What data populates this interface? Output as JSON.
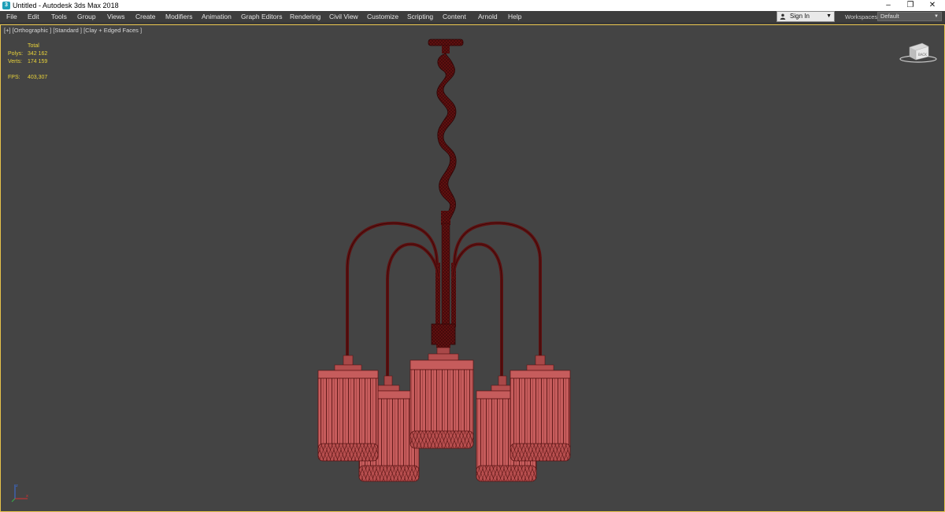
{
  "window": {
    "title": "Untitled - Autodesk 3ds Max 2018",
    "app_icon_glyph": "3",
    "controls": [
      "minimize-icon",
      "restore-icon",
      "close-icon"
    ]
  },
  "menu": [
    "File",
    "Edit",
    "Tools",
    "Group",
    "Views",
    "Create",
    "Modifiers",
    "Animation",
    "Graph Editors",
    "Rendering",
    "Civil View",
    "Customize",
    "Scripting",
    "Content",
    "Arnold",
    "Help"
  ],
  "account": {
    "sign_in_label": "Sign In"
  },
  "workspaces": {
    "label": "Workspaces:",
    "selected": "Default"
  },
  "viewport": {
    "label": "[+] [Orthographic ] [Standard ] [Clay + Edged Faces ]",
    "stats": {
      "header": "Total",
      "polys_label": "Polys:",
      "polys_value": "342 162",
      "verts_label": "Verts:",
      "verts_value": "174 159",
      "fps_label": "FPS:",
      "fps_value": "403,307"
    }
  },
  "colors": {
    "viewport_bg": "#444444",
    "model_fill": "#c65c5c",
    "model_wire": "#5a1414",
    "stats_text": "#e8d23a",
    "active_border": "#e7c34a"
  }
}
